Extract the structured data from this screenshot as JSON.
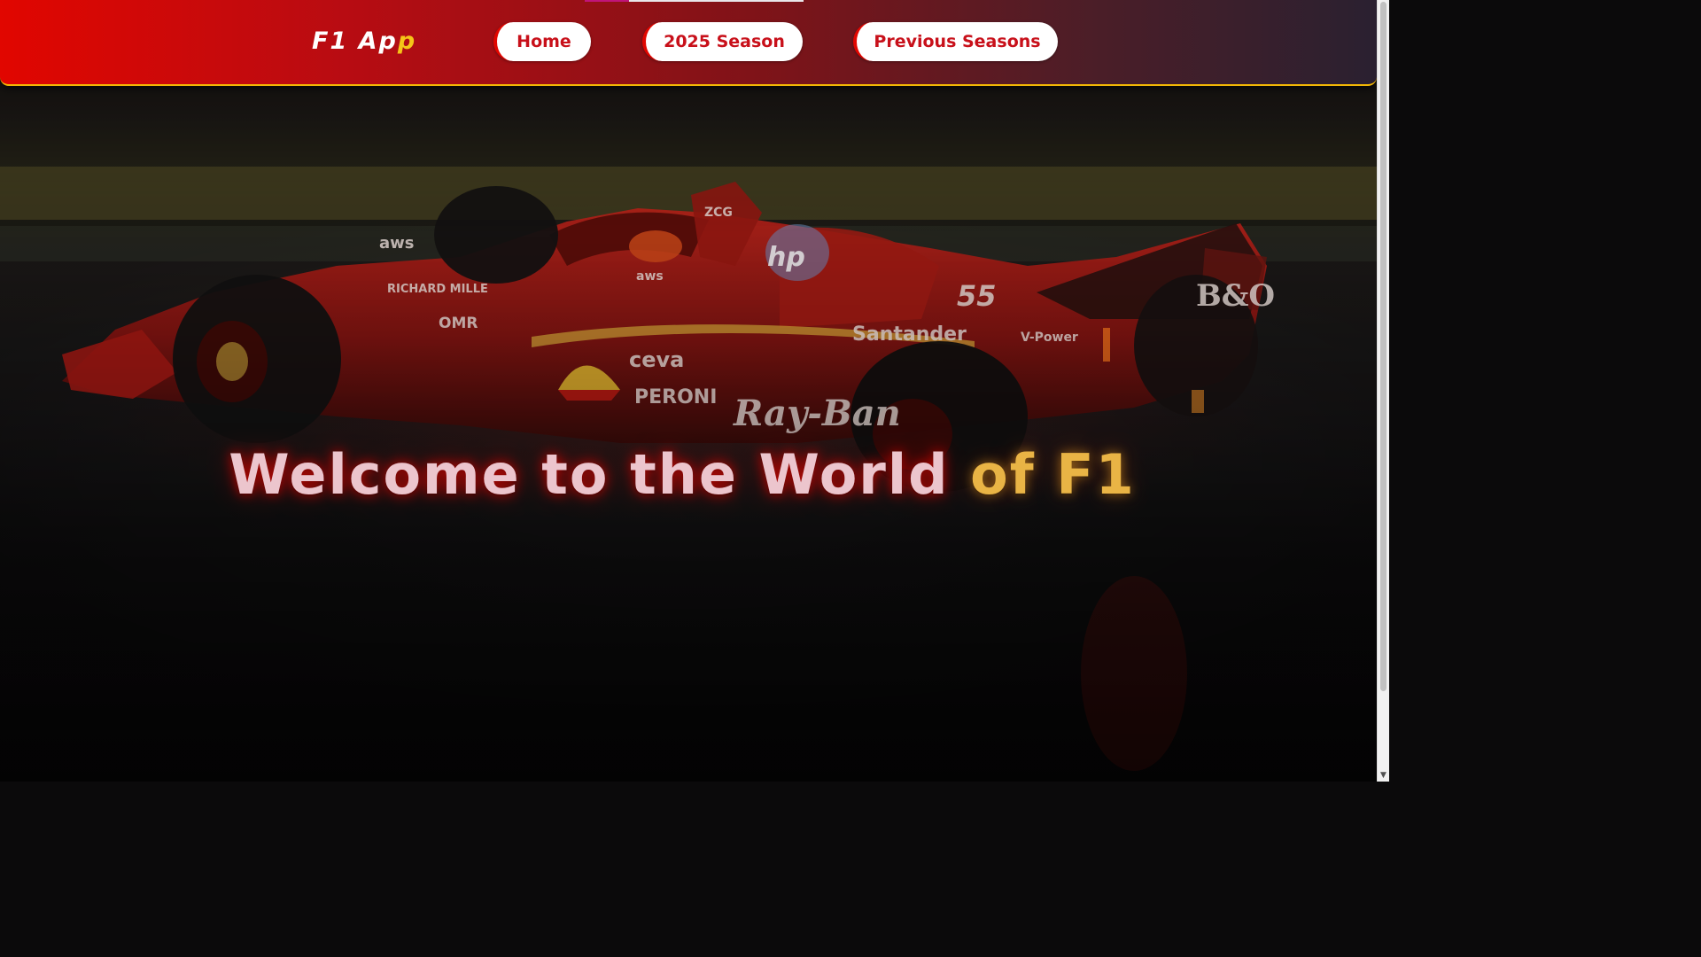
{
  "navbar": {
    "logo_main": "F1 Ap",
    "logo_accent": "p",
    "buttons": [
      {
        "label": "Home"
      },
      {
        "label": "2025 Season"
      },
      {
        "label": "Previous Seasons"
      }
    ]
  },
  "hero": {
    "headline_main": "Welcome to the World ",
    "headline_accent": "of F1",
    "background_image": "ferrari-race-car-photo",
    "car_sponsor_texts": [
      "RICHARD MILLE",
      "ceva",
      "PERONI",
      "Ray-Ban",
      "Santander",
      "55",
      "ZCG",
      "aws",
      "V-Power"
    ]
  },
  "colors": {
    "brand_red": "#e10600",
    "accent_gold": "#f5c518",
    "button_text": "#c8101a"
  }
}
